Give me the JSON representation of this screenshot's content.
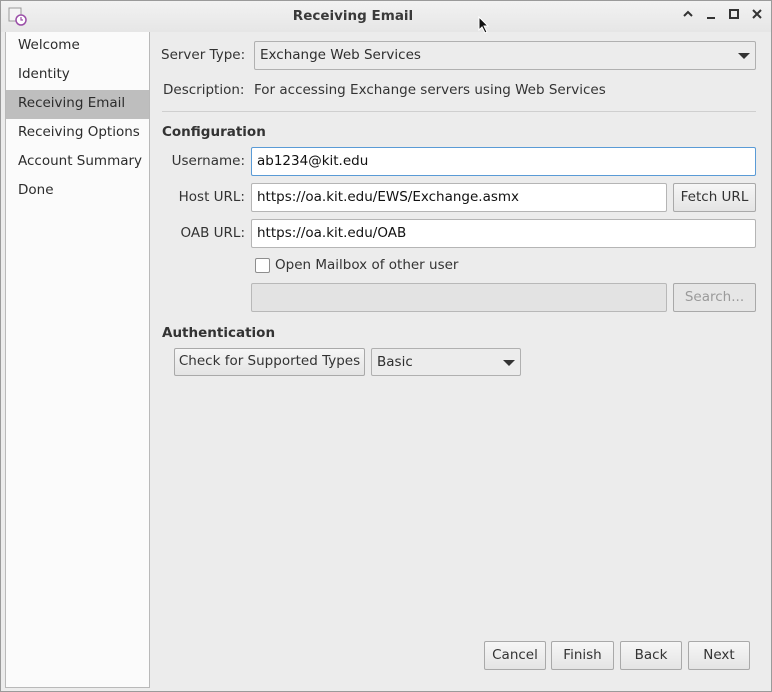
{
  "window": {
    "title": "Receiving Email"
  },
  "sidebar": {
    "items": [
      {
        "label": "Welcome"
      },
      {
        "label": "Identity"
      },
      {
        "label": "Receiving Email"
      },
      {
        "label": "Receiving Options"
      },
      {
        "label": "Account Summary"
      },
      {
        "label": "Done"
      }
    ],
    "active_index": 2
  },
  "form": {
    "server_type_label": "Server Type:",
    "server_type_value": "Exchange Web Services",
    "description_label": "Description:",
    "description_value": "For accessing Exchange servers using Web Services",
    "configuration_heading": "Configuration",
    "username_label": "Username:",
    "username_value": "ab1234@kit.edu",
    "host_url_label": "Host URL:",
    "host_url_value": "https://oa.kit.edu/EWS/Exchange.asmx",
    "fetch_url_label": "Fetch URL",
    "oab_url_label": "OAB URL:",
    "oab_url_value": "https://oa.kit.edu/OAB",
    "open_mailbox_label": "Open Mailbox of other user",
    "open_mailbox_checked": false,
    "other_user_value": "",
    "search_label": "Search...",
    "authentication_heading": "Authentication",
    "check_types_label": "Check for Supported Types",
    "auth_type_value": "Basic"
  },
  "footer": {
    "cancel_label": "Cancel",
    "finish_label": "Finish",
    "back_label": "Back",
    "next_label": "Next"
  },
  "colors": {
    "selected_row": "#bebebe",
    "focus_border": "#5a9bd6"
  }
}
